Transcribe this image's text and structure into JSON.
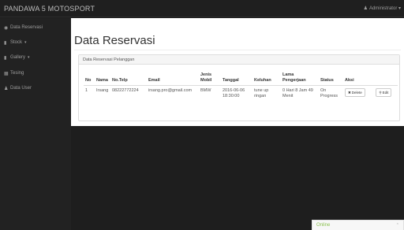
{
  "topbar": {
    "brand": "PANDAWA 5 MOTOSPORT",
    "user_label": "Administrator",
    "user_icon": "user-icon"
  },
  "sidebar": {
    "items": [
      {
        "label": "Data Reservasi",
        "icon": "dashboard-icon",
        "caret": ""
      },
      {
        "label": "Stock",
        "icon": "bar-chart-icon",
        "caret": "▾"
      },
      {
        "label": "Gallery",
        "icon": "bar-chart-icon",
        "caret": "▾"
      },
      {
        "label": "Tesing",
        "icon": "table-icon",
        "caret": ""
      },
      {
        "label": "Data User",
        "icon": "user-icon",
        "caret": ""
      }
    ]
  },
  "main": {
    "title": "Data Reservasi",
    "panel_heading": "Data Reservasi Pelanggan",
    "columns": [
      "No",
      "Nama",
      "No.Telp",
      "Email",
      "Jenis Mobil",
      "Tanggal",
      "Keluhan",
      "Lama Pengerjaan",
      "Status",
      "Aksi"
    ],
    "rows": [
      {
        "no": "1",
        "nama": "Irsang",
        "telp": "08222772224",
        "email": "irsang.pro@gmail.com",
        "mobil": "BMW",
        "tanggal": "2016-06-06 18:30:00",
        "keluhan": "tune up ringan",
        "lama": "0 Hari 8 Jam 49 Menit",
        "status": "On Progress",
        "actions": [
          "Delete",
          "Edit"
        ]
      }
    ]
  },
  "chat": {
    "label": "Online",
    "caret": "⌃"
  },
  "colors": {
    "topbar": "#1f1f1f",
    "sidebar": "#222222",
    "content": "#ffffff",
    "online": "#8cc152"
  }
}
